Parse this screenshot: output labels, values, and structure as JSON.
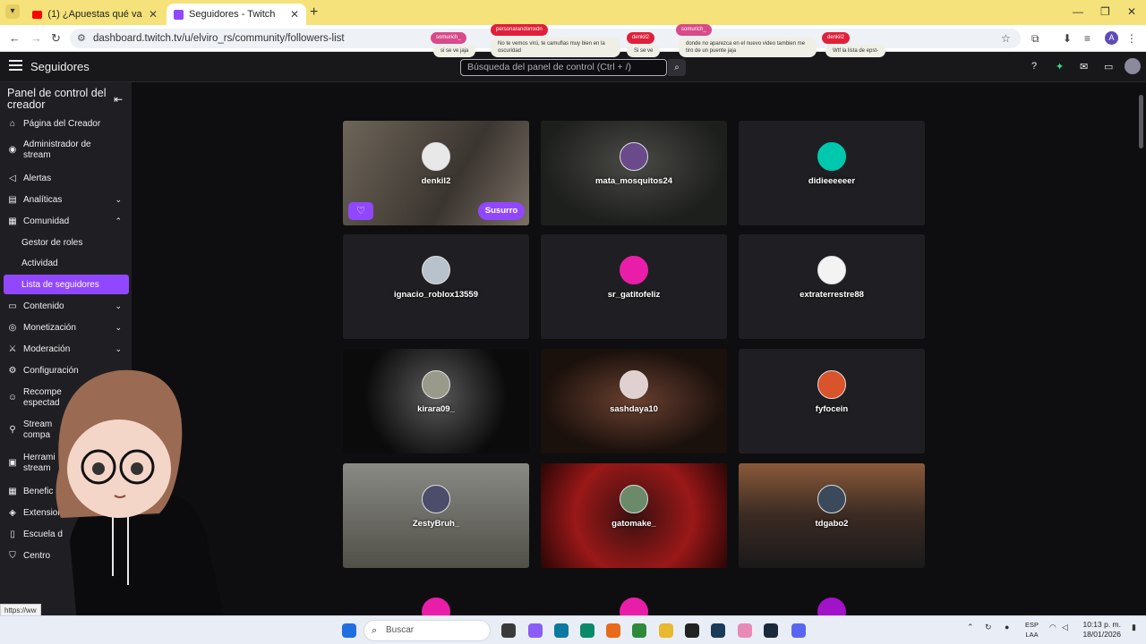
{
  "browser": {
    "tabs": [
      {
        "title": "(1) ¿Apuestas qué va a pasar en",
        "icon": "youtube-icon"
      },
      {
        "title": "Seguidores - Twitch",
        "icon": "twitch-icon"
      }
    ],
    "url": "dashboard.twitch.tv/u/elviro_rs/community/followers-list",
    "profile_initial": "A"
  },
  "chat_overlay": [
    {
      "user": "somurich_",
      "text": "si se ve jaja"
    },
    {
      "user": "personarandomxdn",
      "text": "No te vemos virú, te camuflas muy bien en la oscuridad"
    },
    {
      "user": "denkil2",
      "text": "Si se ve"
    },
    {
      "user": "somurich_",
      "text": "donde no aparezca en el nuevo video tambien me tiro de un puente jaja"
    },
    {
      "user": "denkil2",
      "text": "Wtf la lista de epst-"
    }
  ],
  "header": {
    "title": "Seguidores",
    "search_placeholder": "Búsqueda del panel de control (Ctrl + /)"
  },
  "sidebar": {
    "title": "Panel de control del creador",
    "items": [
      {
        "label": "Página del Creador",
        "icon": "home-icon"
      },
      {
        "label": "Administrador de stream",
        "icon": "broadcast-icon"
      },
      {
        "label": "Alertas",
        "icon": "megaphone-icon"
      },
      {
        "label": "Analíticas",
        "icon": "chart-icon"
      },
      {
        "label": "Comunidad",
        "icon": "people-icon"
      },
      {
        "label": "Contenido",
        "icon": "film-icon"
      },
      {
        "label": "Monetización",
        "icon": "coin-icon"
      },
      {
        "label": "Moderación",
        "icon": "sword-icon"
      },
      {
        "label": "Configuración",
        "icon": "gear-icon"
      },
      {
        "label": "Recompe espectad",
        "icon": "reward-icon"
      },
      {
        "label": "Stream compa",
        "icon": "collab-icon"
      },
      {
        "label": "Herrami stream",
        "icon": "camera-icon"
      },
      {
        "label": "Benefic",
        "icon": "gift-icon"
      },
      {
        "label": "Extensiones",
        "icon": "puzzle-icon"
      },
      {
        "label": "Escuela d",
        "icon": "book-icon"
      },
      {
        "label": "Centro",
        "icon": "shield-icon"
      }
    ],
    "community_sub": [
      "Gestor de roles",
      "Actividad",
      "Lista de seguidores"
    ]
  },
  "followers": [
    {
      "name": "denkil2"
    },
    {
      "name": "mata_mosquitos24"
    },
    {
      "name": "didieeeeeer"
    },
    {
      "name": "ignacio_roblox13559"
    },
    {
      "name": "sr_gatitofeliz"
    },
    {
      "name": "extraterrestre88"
    },
    {
      "name": "kirara09_"
    },
    {
      "name": "sashdaya10"
    },
    {
      "name": "fyfocein"
    },
    {
      "name": "ZestyBruh_"
    },
    {
      "name": "gatomake_"
    },
    {
      "name": "tdgabo2"
    }
  ],
  "card_actions": {
    "whisper": "Susurro"
  },
  "status_url": "https://ww",
  "taskbar": {
    "search": "Buscar",
    "lang_top": "ESP",
    "lang_bottom": "LAA",
    "time": "10:13 p. m.",
    "date": "18/01/2026"
  }
}
